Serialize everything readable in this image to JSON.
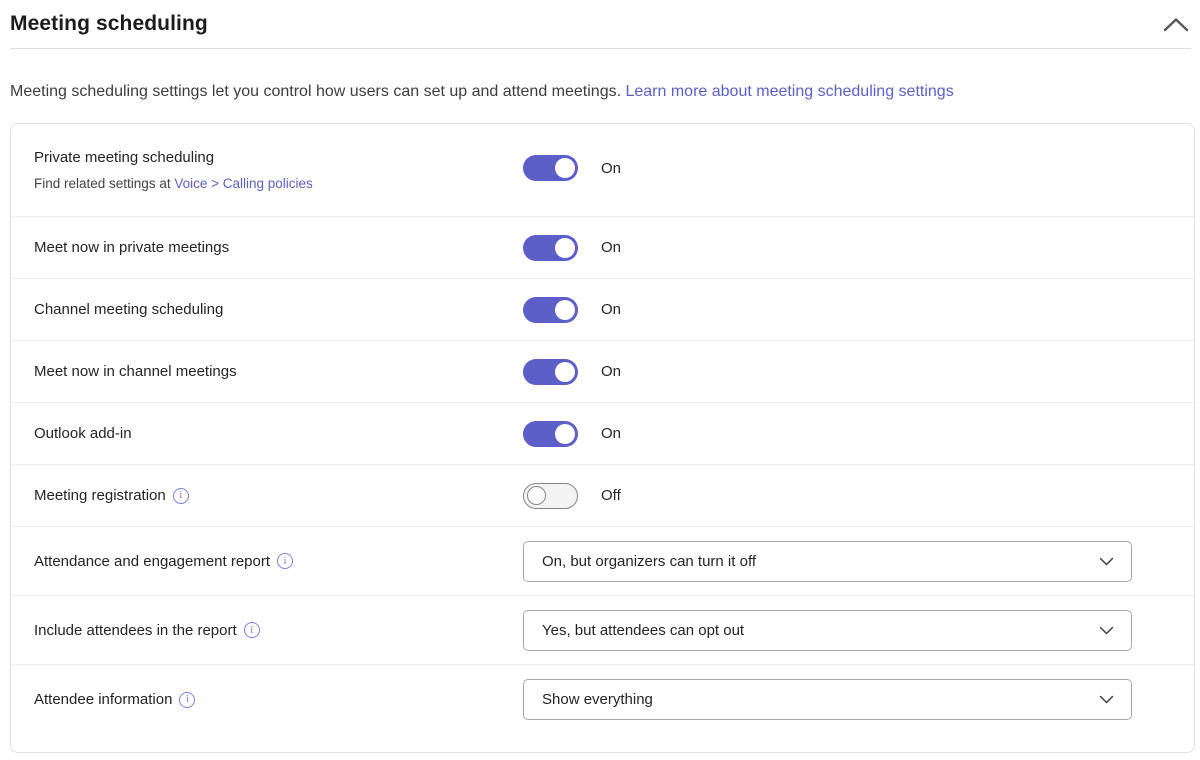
{
  "header": {
    "title": "Meeting scheduling"
  },
  "description": {
    "text": "Meeting scheduling settings let you control how users can set up and attend meetings.",
    "link_text": "Learn more about meeting scheduling settings"
  },
  "icons": {
    "info_glyph": "i"
  },
  "colors": {
    "accent": "#5b5fc7",
    "link": "#5b5fc7",
    "toggle_off_border": "#868686",
    "divider": "#ececec",
    "text": "#242424"
  },
  "rows": [
    {
      "label": "Private meeting scheduling",
      "control": "toggle",
      "state": "on",
      "state_label": "On",
      "subtext": "Find related settings at",
      "subtext_link": "Voice > Calling policies"
    },
    {
      "label": "Meet now in private meetings",
      "control": "toggle",
      "state": "on",
      "state_label": "On"
    },
    {
      "label": "Channel meeting scheduling",
      "control": "toggle",
      "state": "on",
      "state_label": "On"
    },
    {
      "label": "Meet now in channel meetings",
      "control": "toggle",
      "state": "on",
      "state_label": "On"
    },
    {
      "label": "Outlook add-in",
      "control": "toggle",
      "state": "on",
      "state_label": "On"
    },
    {
      "label": "Meeting registration",
      "has_info": true,
      "control": "toggle",
      "state": "off",
      "state_label": "Off"
    },
    {
      "label": "Attendance and engagement report",
      "has_info": true,
      "control": "dropdown",
      "value": "On, but organizers can turn it off"
    },
    {
      "label": "Include attendees in the report",
      "has_info": true,
      "control": "dropdown",
      "value": "Yes, but attendees can opt out"
    },
    {
      "label": "Attendee information",
      "has_info": true,
      "control": "dropdown",
      "value": "Show everything"
    }
  ]
}
